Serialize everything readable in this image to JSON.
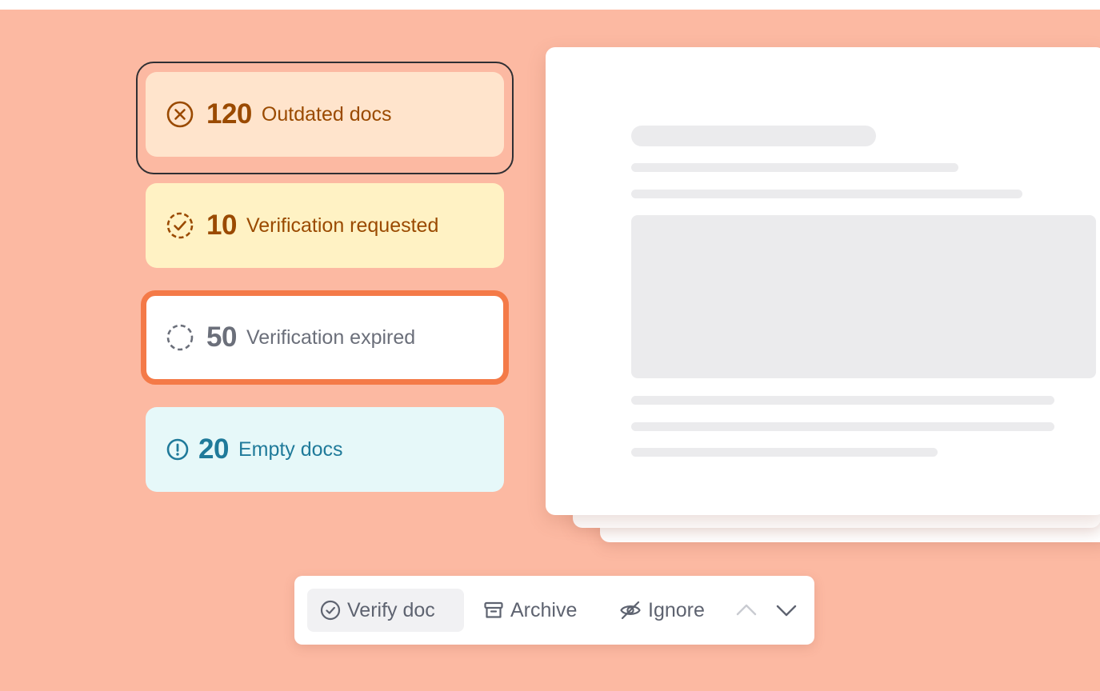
{
  "filters": [
    {
      "count": "120",
      "label": "Outdated docs",
      "icon": "x-circle-icon",
      "color": "#9a4a00",
      "background": "#ffe4cc"
    },
    {
      "count": "10",
      "label": "Verification requested",
      "icon": "dashed-check-circle-icon",
      "color": "#9a4a00",
      "background": "#fff2c4"
    },
    {
      "count": "50",
      "label": "Verification expired",
      "icon": "dashed-circle-icon",
      "color": "#6b6f7a",
      "background": "#ffffff",
      "border": "#f47a48"
    },
    {
      "count": "20",
      "label": "Empty docs",
      "icon": "alert-circle-icon",
      "color": "#1f7a9a",
      "background": "#e6f8f9"
    }
  ],
  "toolbar": {
    "verify_label": "Verify doc",
    "archive_label": "Archive",
    "ignore_label": "Ignore"
  },
  "colors": {
    "canvas": "#fcb9a2",
    "accent": "#f47a48"
  }
}
